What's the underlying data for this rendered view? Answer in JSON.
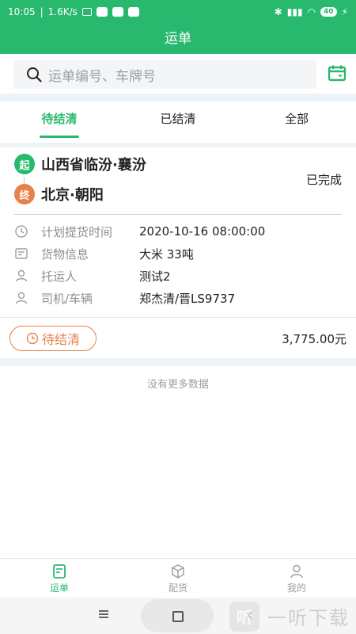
{
  "status_bar": {
    "time": "10:05",
    "network_speed": "1.6K/s",
    "battery": "40"
  },
  "header": {
    "title": "运单"
  },
  "search": {
    "placeholder": "运单编号、车牌号",
    "calendar_icon": "calendar-icon"
  },
  "tabs": [
    {
      "label": "待结清",
      "active": true
    },
    {
      "label": "已结清",
      "active": false
    },
    {
      "label": "全部",
      "active": false
    }
  ],
  "waybill": {
    "origin_badge": "起",
    "origin": "山西省临汾·襄汾",
    "dest_badge": "终",
    "destination": "北京·朝阳",
    "status": "已完成",
    "rows": [
      {
        "icon": "clock-icon",
        "label": "计划提货时间",
        "value": "2020-10-16 08:00:00"
      },
      {
        "icon": "goods-icon",
        "label": "货物信息",
        "value": "大米 33吨"
      },
      {
        "icon": "person-icon",
        "label": "托运人",
        "value": "测试2"
      },
      {
        "icon": "driver-icon",
        "label": "司机/车辆",
        "value": "郑杰清/晋LS9737"
      }
    ],
    "settle_label": "待结清",
    "amount": "3,775.00元"
  },
  "list_footer": "没有更多数据",
  "bottom_nav": [
    {
      "label": "运单",
      "icon": "waybill-icon",
      "active": true
    },
    {
      "label": "配货",
      "icon": "box-icon",
      "active": false
    },
    {
      "label": "我的",
      "icon": "user-icon",
      "active": false
    }
  ],
  "watermark": {
    "logo_glyph": "听",
    "text": "一听下载"
  },
  "colors": {
    "brand_green": "#29b96e",
    "origin_badge": "#29b96e",
    "dest_badge": "#e7814a",
    "settle_orange": "#e7814a"
  }
}
